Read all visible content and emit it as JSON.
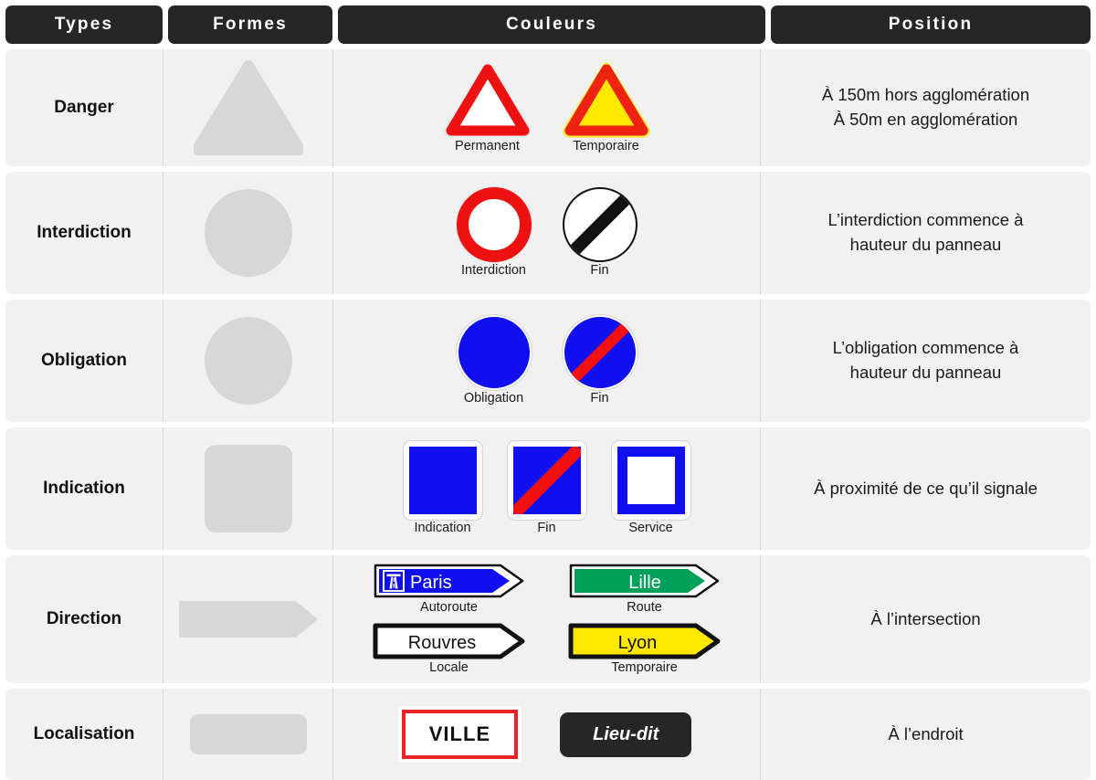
{
  "header": {
    "columns": [
      {
        "label": "Types"
      },
      {
        "label": "Formes"
      },
      {
        "label": "Couleurs"
      },
      {
        "label": "Position"
      }
    ]
  },
  "colors": {
    "header_bg": "#262626",
    "cell_bg": "#f1f1f1",
    "page_bg": "#ffffff",
    "shape_grey": "#d7d7d7",
    "sign_red": "#ee1111",
    "sign_blue": "#1010ee",
    "sign_yellow": "#ffe800",
    "sign_green": "#00a15a",
    "sign_black": "#111111",
    "divider": "#d8d8d8"
  },
  "rows": [
    {
      "type": "Danger",
      "shape": "triangle",
      "signs": [
        {
          "caption": "Permanent",
          "art": "triangle-white-red"
        },
        {
          "caption": "Temporaire",
          "art": "triangle-yellow-red"
        }
      ],
      "position": "À 150m hors agglomération\nÀ 50m en agglomération"
    },
    {
      "type": "Interdiction",
      "shape": "circle",
      "signs": [
        {
          "caption": "Interdiction",
          "art": "disc-red-ring"
        },
        {
          "caption": "Fin",
          "art": "disc-white-black-stripe"
        }
      ],
      "position": "L’interdiction commence à\nhauteur du panneau"
    },
    {
      "type": "Obligation",
      "shape": "circle",
      "signs": [
        {
          "caption": "Obligation",
          "art": "disc-blue"
        },
        {
          "caption": "Fin",
          "art": "disc-blue-red-stripe"
        }
      ],
      "position": "L’obligation commence à\nhauteur du panneau"
    },
    {
      "type": "Indication",
      "shape": "rounded-square",
      "signs": [
        {
          "caption": "Indication",
          "art": "square-blue"
        },
        {
          "caption": "Fin",
          "art": "square-blue-red-stripe"
        },
        {
          "caption": "Service",
          "art": "square-blue-frame-white"
        }
      ],
      "position": "À proximité de ce qu’il signale"
    },
    {
      "type": "Direction",
      "shape": "arrow",
      "signs": [
        {
          "caption": "Autoroute",
          "art": "arrow-blue",
          "text": "Paris",
          "icon": "motorway-icon"
        },
        {
          "caption": "Route",
          "art": "arrow-green",
          "text": "Lille"
        },
        {
          "caption": "Locale",
          "art": "arrow-white",
          "text": "Rouvres"
        },
        {
          "caption": "Temporaire",
          "art": "arrow-yellow",
          "text": "Lyon"
        }
      ],
      "position": "À l’intersection"
    },
    {
      "type": "Localisation",
      "shape": "rounded-rect",
      "signs": [
        {
          "caption": "",
          "art": "plate-white-red-border",
          "text": "VILLE"
        },
        {
          "caption": "",
          "art": "plate-dark",
          "text": "Lieu-dit"
        }
      ],
      "position": "À l’endroit"
    }
  ]
}
